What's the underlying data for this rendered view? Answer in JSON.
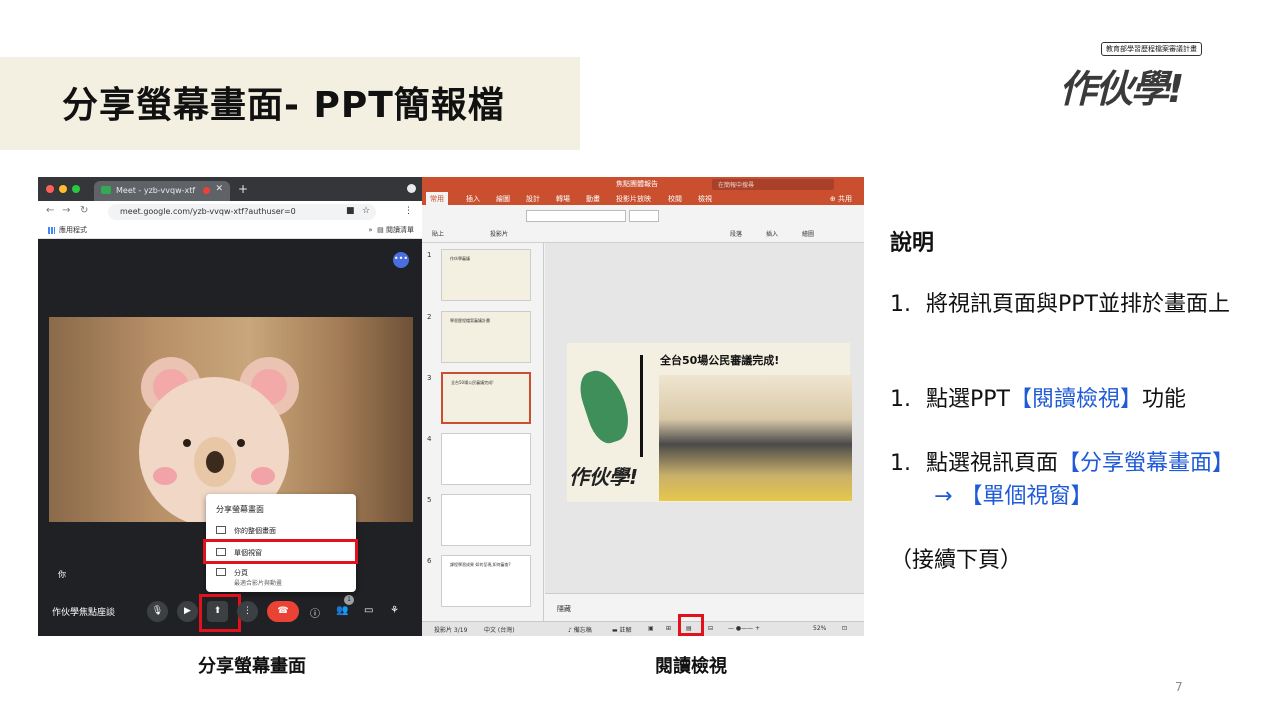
{
  "title": "分享螢幕畫面- PPT簡報檔",
  "logo": {
    "tagline": "教育部學習歷程檔案審議計畫",
    "word": "作伙學!"
  },
  "meet": {
    "tab_title": "Meet - yzb-vvqw-xtf",
    "url": "meet.google.com/yzb-vvqw-xtf?authuser=0",
    "bookmark_apps": "應用程式",
    "bookmark_reading_list": "閱讀清單",
    "self_label": "你",
    "meeting_name": "作伙學焦點座談",
    "participants_count": "1",
    "share_menu": {
      "title": "分享螢幕畫面",
      "items": [
        {
          "label": "你的整個畫面",
          "sub": ""
        },
        {
          "label": "單個視窗",
          "sub": ""
        },
        {
          "label": "分頁",
          "sub": "最適合影片與動畫"
        }
      ]
    }
  },
  "ppt": {
    "window_title": "焦點團體報告",
    "search_placeholder": "在簡報中搜尋",
    "tabs": [
      "常用",
      "插入",
      "繪圖",
      "設計",
      "轉場",
      "動畫",
      "投影片放映",
      "校閱",
      "檢視"
    ],
    "share_label": "共用",
    "ribbon_labels": {
      "paste": "貼上",
      "slides": "投影片",
      "paragraph": "段落",
      "insert": "插入",
      "draw": "繪圖"
    },
    "thumbnails": [
      {
        "num": "1",
        "title": "作伙學審議"
      },
      {
        "num": "2",
        "title": "學習歷程檔案審議計畫"
      },
      {
        "num": "3",
        "title": "全台50場公民審議完成!"
      },
      {
        "num": "4",
        "title": ""
      },
      {
        "num": "5",
        "title": ""
      },
      {
        "num": "6",
        "title": "課程學習成果 如何呈現,如何審查?"
      }
    ],
    "slide_title": "全台50場公民審議完成!",
    "slide_logo": "作伙學!",
    "notes_label": "隱藏",
    "status": {
      "slide_index": "投影片 3/19",
      "language": "中文 (台灣)",
      "notes": "備忘稿",
      "comments": "註解",
      "zoom": "52%"
    }
  },
  "captions": {
    "left": "分享螢幕畫面",
    "right": "閱讀檢視"
  },
  "description": {
    "heading": "說明",
    "items": [
      {
        "num": "1.",
        "text": "將視訊頁面與PPT並排於畫面上"
      },
      {
        "num": "1.",
        "text_pre": "點選PPT",
        "text_hl": "【閱讀檢視】",
        "text_post": "功能"
      },
      {
        "num": "1.",
        "text_pre": "點選視訊頁面",
        "text_hl": "【分享螢幕畫面】",
        "arrow": "→",
        "text_hl2": "【單個視窗】"
      }
    ],
    "continued": "（接續下頁）"
  },
  "page_number": "7",
  "colors": {
    "accent_red": "#e0121b",
    "link_blue": "#1f5bd6",
    "ppt_orange": "#c94f2f",
    "title_band": "#f4f0e1"
  }
}
